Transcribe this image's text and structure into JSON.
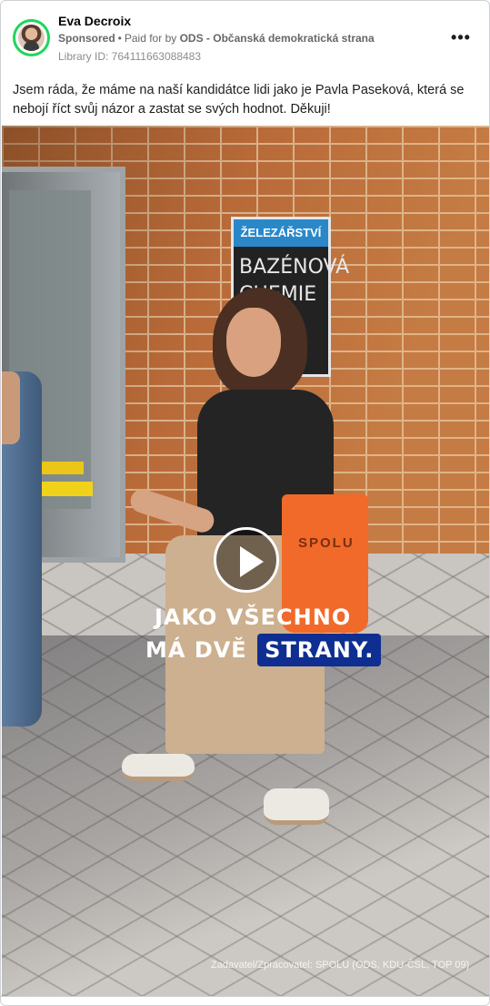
{
  "post": {
    "author": "Eva Decroix",
    "sponsored_label": "Sponsored",
    "separator": "•",
    "paid_prefix": "Paid for by",
    "payer": "ODS - Občanská demokratická strana",
    "library_id": "Library ID: 764111663088483",
    "text": "Jsem ráda, že máme na naší kandidátce lidi jako je Pavla Paseková, která se nebojí říct svůj názor a zastat se svých hodnot. Děkuji!",
    "more_icon": "more-horizontal-icon",
    "more_glyph": "•••"
  },
  "video": {
    "play_icon": "play-icon",
    "caption_line1": "JAKO VŠECHNO",
    "caption_line2_prefix": "MÁ DVĚ",
    "caption_line2_highlight": "STRANY.",
    "highlight_color": "#0e2e91",
    "disclaimer": "Zadavatel/Zpracovatel: SPOLU (ODS, KDU-ČSL, TOP 09)",
    "shop_sign_header": "ŽELEZÁŘSTVÍ",
    "shop_sign_body": "BAZÉNOVÁ CHEMIE ...ATY",
    "bag_text": "SPOLU"
  },
  "colors": {
    "avatar_ring": "#1fd65a",
    "bag": "#f16a2a"
  }
}
